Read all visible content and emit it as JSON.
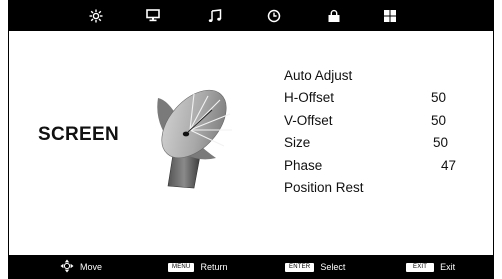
{
  "tabs": [
    {
      "icon": "picture-icon"
    },
    {
      "icon": "screen-icon",
      "active": true
    },
    {
      "icon": "audio-icon"
    },
    {
      "icon": "time-icon"
    },
    {
      "icon": "lock-icon"
    },
    {
      "icon": "setup-icon"
    }
  ],
  "page": {
    "title": "SCREEN",
    "illustration": "satellite-dish-icon"
  },
  "menu": {
    "items": [
      {
        "label": "Auto Adjust",
        "value": ""
      },
      {
        "label": "H-Offset",
        "value": "50"
      },
      {
        "label": "V-Offset",
        "value": "50"
      },
      {
        "label": "Size",
        "value": "50"
      },
      {
        "label": "Phase",
        "value": "47"
      },
      {
        "label": "Position Rest",
        "value": ""
      }
    ]
  },
  "footer": {
    "move": {
      "icon": "four-way-arrow-icon",
      "label": "Move"
    },
    "return": {
      "key": "MENU",
      "label": "Return"
    },
    "select": {
      "key": "ENTER",
      "label": "Select"
    },
    "exit": {
      "key": "EXIT",
      "label": "Exit"
    }
  },
  "colors": {
    "bar": "#000000",
    "background": "#ffffff",
    "text": "#111111"
  }
}
